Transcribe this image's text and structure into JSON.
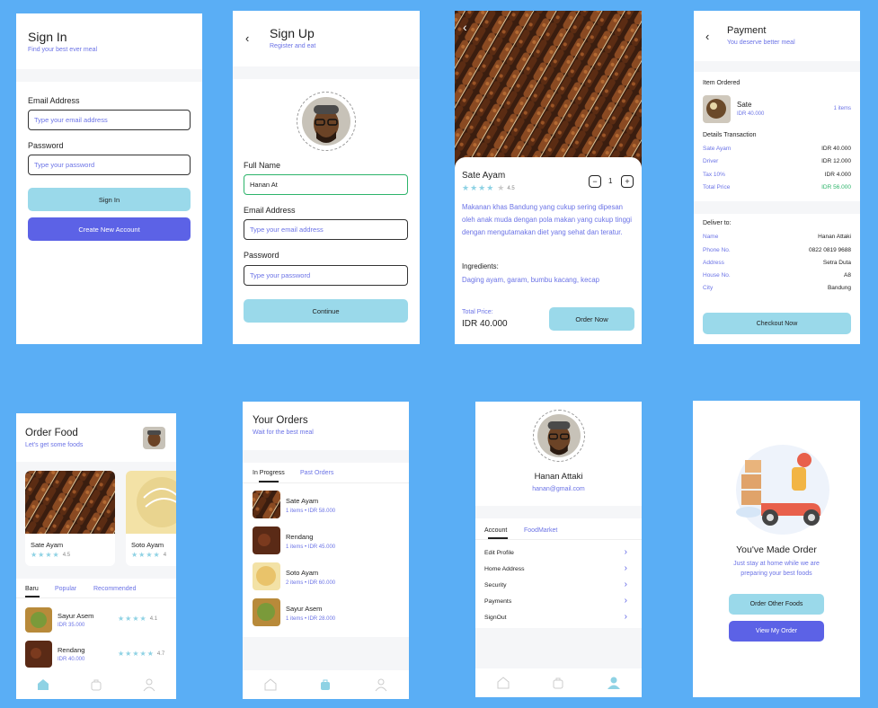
{
  "signin": {
    "title": "Sign In",
    "subtitle": "Find your best ever meal",
    "email_label": "Email Address",
    "email_placeholder": "Type your email address",
    "password_label": "Password",
    "password_placeholder": "Type your password",
    "signin_button": "Sign In",
    "create_button": "Create New Account"
  },
  "signup": {
    "title": "Sign Up",
    "subtitle": "Register and eat",
    "fullname_label": "Full Name",
    "fullname_value": "Hanan At",
    "email_label": "Email Address",
    "email_placeholder": "Type your email address",
    "password_label": "Password",
    "password_placeholder": "Type your password",
    "continue_button": "Continue"
  },
  "detail": {
    "name": "Sate Ayam",
    "rating": "4.5",
    "quantity": "1",
    "minus": "−",
    "plus": "+",
    "description": "Makanan khas Bandung yang cukup sering dipesan oleh anak muda dengan pola makan yang cukup tinggi dengan mengutamakan diet yang sehat dan teratur.",
    "ingredients_label": "Ingredients:",
    "ingredients": "Daging ayam, garam, bumbu kacang, kecap",
    "total_label": "Total Price:",
    "total_value": "IDR 40.000",
    "order_button": "Order Now"
  },
  "payment": {
    "title": "Payment",
    "subtitle": "You deserve better meal",
    "item_ordered": "Item Ordered",
    "item_name": "Sate",
    "item_price": "IDR 40.000",
    "item_count": "1 items",
    "details_title": "Details Transaction",
    "details": [
      {
        "label": "Sate Ayam",
        "value": "IDR 40.000"
      },
      {
        "label": "Driver",
        "value": "IDR 12.000"
      },
      {
        "label": "Tax 10%",
        "value": "IDR 4.000"
      },
      {
        "label": "Total Price",
        "value": "IDR 56.000"
      }
    ],
    "deliver_title": "Deliver to:",
    "deliver": [
      {
        "label": "Name",
        "value": "Hanan Attaki"
      },
      {
        "label": "Phone No.",
        "value": "0822 0819 9688"
      },
      {
        "label": "Address",
        "value": "Setra Duta"
      },
      {
        "label": "House No.",
        "value": "A8"
      },
      {
        "label": "City",
        "value": "Bandung"
      }
    ],
    "checkout_button": "Checkout Now"
  },
  "orderfood": {
    "title": "Order Food",
    "subtitle": "Let's get some foods",
    "cards": [
      {
        "name": "Sate Ayam",
        "rating": "4.5"
      },
      {
        "name": "Soto Ayam",
        "rating": "4"
      }
    ],
    "tabs": [
      "Baru",
      "Popular",
      "Recommended"
    ],
    "list": [
      {
        "name": "Sayur Asem",
        "price": "IDR 35.000",
        "rating": "4.1"
      },
      {
        "name": "Rendang",
        "price": "IDR 40.000",
        "rating": "4.7"
      }
    ]
  },
  "yourorders": {
    "title": "Your Orders",
    "subtitle": "Wait for the best meal",
    "tabs": [
      "In Progress",
      "Past Orders"
    ],
    "orders": [
      {
        "name": "Sate Ayam",
        "meta": "1 items • IDR 58.000"
      },
      {
        "name": "Rendang",
        "meta": "1 items • IDR 45.000"
      },
      {
        "name": "Soto Ayam",
        "meta": "2 items • IDR 60.000"
      },
      {
        "name": "Sayur Asem",
        "meta": "1 items • IDR 28.000"
      }
    ]
  },
  "profile": {
    "name": "Hanan Attaki",
    "email": "hanan@gmail.com",
    "tabs": [
      "Account",
      "FoodMarket"
    ],
    "menu": [
      "Edit Profile",
      "Home Address",
      "Security",
      "Payments",
      "SignOut"
    ]
  },
  "success": {
    "title": "You've Made Order",
    "line1": "Just stay at home while we are",
    "line2": "preparing your best foods",
    "order_other": "Order Other Foods",
    "view_order": "View My Order"
  },
  "colors": {
    "accent": "#5c62e6",
    "light": "#9ad9ea",
    "background": "#5aaef5",
    "success": "#2cb46a"
  }
}
